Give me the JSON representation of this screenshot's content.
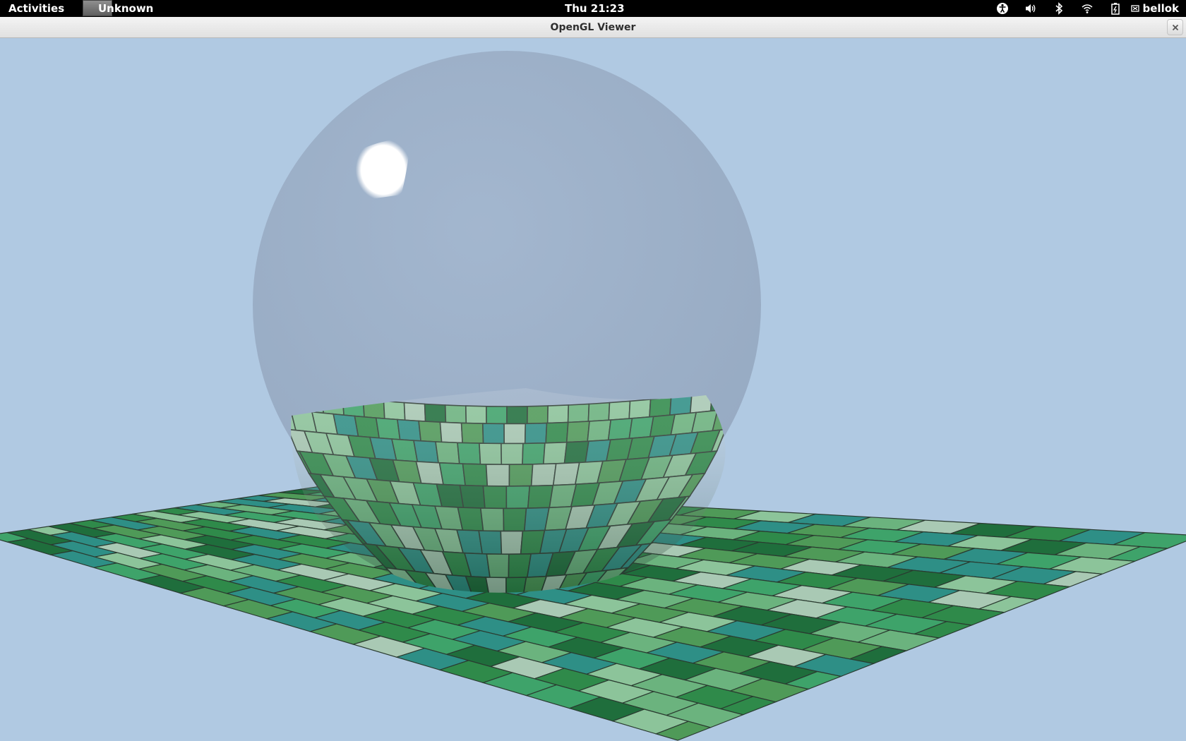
{
  "topbar": {
    "activities_label": "Activities",
    "app_menu_label": "Unknown",
    "clock": "Thu 21:23",
    "tray_icons": [
      "accessibility-icon",
      "volume-icon",
      "bluetooth-icon",
      "wifi-icon",
      "battery-icon"
    ],
    "user_name": "bellok"
  },
  "window": {
    "title": "OpenGL Viewer",
    "close_icon": "close-icon"
  },
  "scene": {
    "background_color": "#b0c9e2",
    "objects": [
      "glass-sphere",
      "tiled-bowl",
      "tiled-floor"
    ],
    "tile_colors": [
      "#2f8a4a",
      "#3ea36a",
      "#6bb37e",
      "#2e8f86",
      "#8cc49a",
      "#1f6e3c",
      "#a9c9b4",
      "#4f9a58"
    ]
  }
}
